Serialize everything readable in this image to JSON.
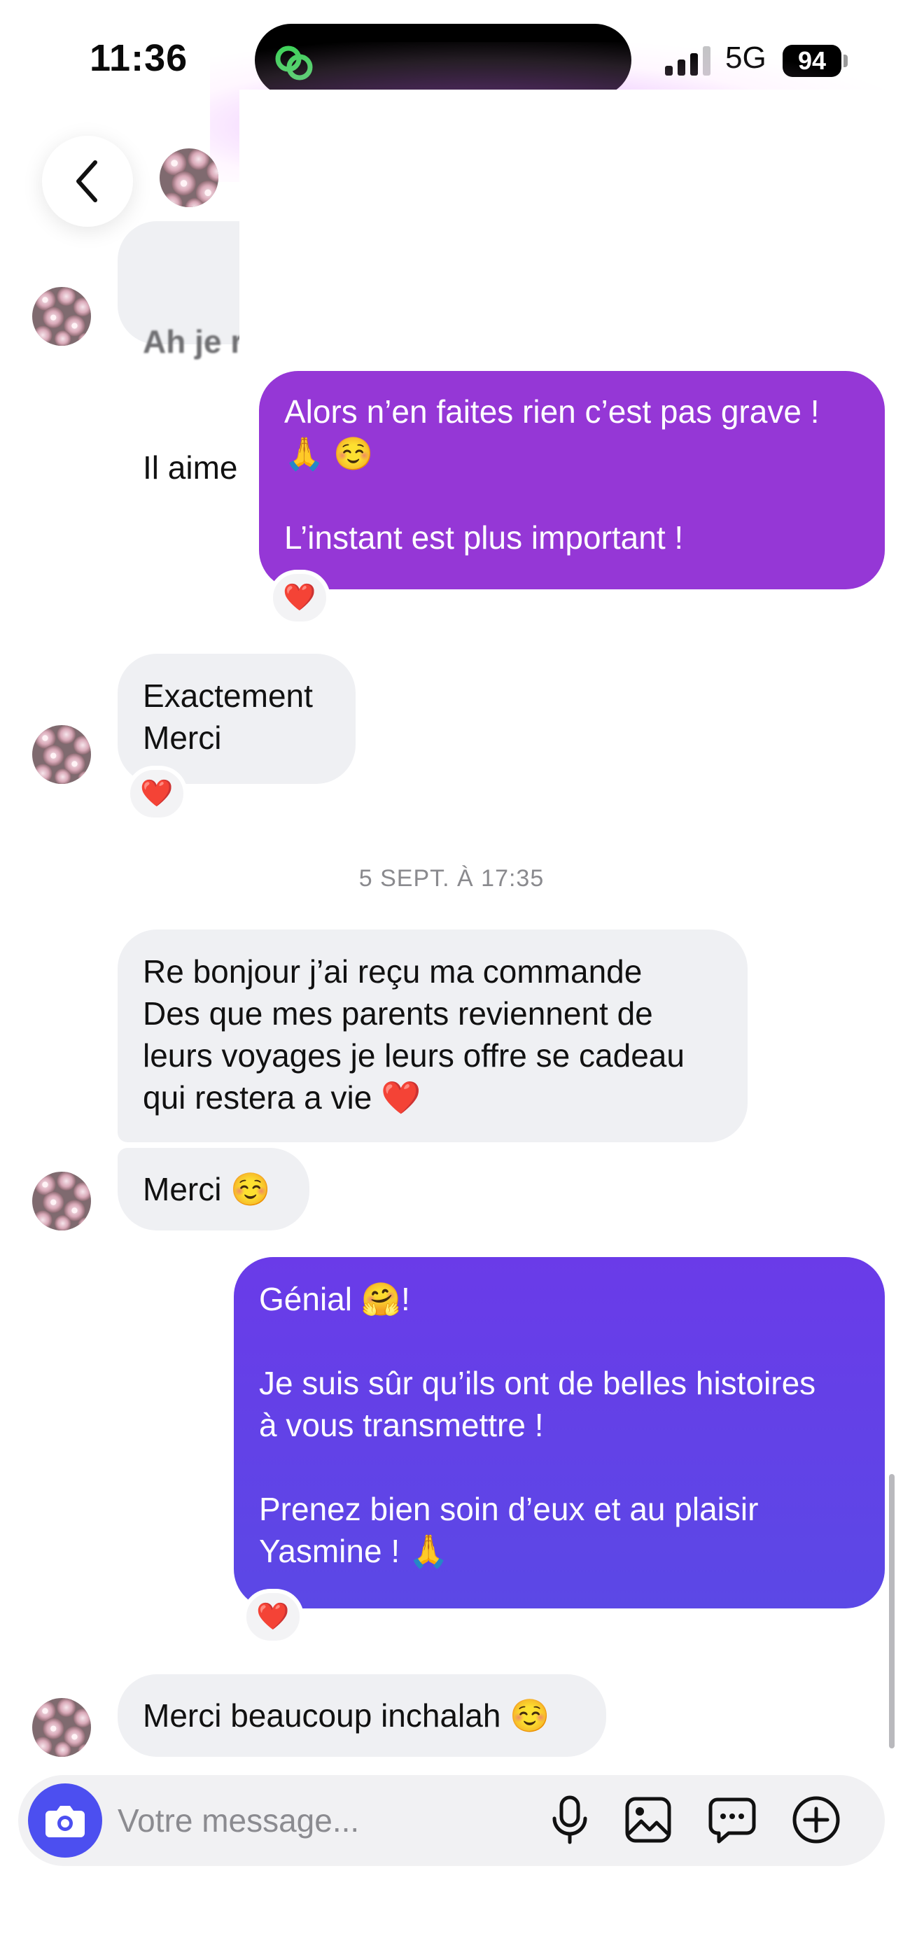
{
  "status_bar": {
    "time": "11:36",
    "network": "5G",
    "battery": "94",
    "island_icon": "threads-link-icon"
  },
  "header": {
    "back_icon": "chevron-left-icon",
    "avatar_icon": "flower-avatar"
  },
  "messages": [
    {
      "id": "m1",
      "direction": "in",
      "text_faded": "Ah je r",
      "text": "Il aime"
    },
    {
      "id": "m2",
      "direction": "out",
      "text": "Alors n’en faites rien c’est pas grave !\n🙏 ☺️\n\nL’instant est plus important !",
      "reaction": "❤️"
    },
    {
      "id": "m3",
      "direction": "in",
      "text": "Exactement\nMerci",
      "reaction": "❤️"
    },
    {
      "id": "m4",
      "direction": "in",
      "text": "Re bonjour j’ai reçu ma commande\nDes que mes parents reviennent de\nleurs voyages je leurs offre se cadeau\nqui restera a vie ❤️"
    },
    {
      "id": "m5",
      "direction": "in",
      "text": "Merci ☺️"
    },
    {
      "id": "m6",
      "direction": "out",
      "text": "Génial 🤗!\n\nJe suis sûr qu’ils ont de belles histoires\nà vous transmettre !\n\nPrenez bien soin d’eux et au plaisir\nYasmine ! 🙏",
      "reaction": "❤️"
    },
    {
      "id": "m7",
      "direction": "in",
      "text": "Merci beaucoup inchalah ☺️"
    }
  ],
  "date_divider": "5 SEPT. À 17:35",
  "composer": {
    "placeholder": "Votre message...",
    "icons": [
      "camera-icon",
      "microphone-icon",
      "image-icon",
      "sticker-icon",
      "plus-icon"
    ]
  },
  "colors": {
    "outgoing_1": "#9537d6",
    "outgoing_2": "#5b48e6",
    "incoming": "#eff0f3",
    "camera_button": "#4c4ff0"
  }
}
